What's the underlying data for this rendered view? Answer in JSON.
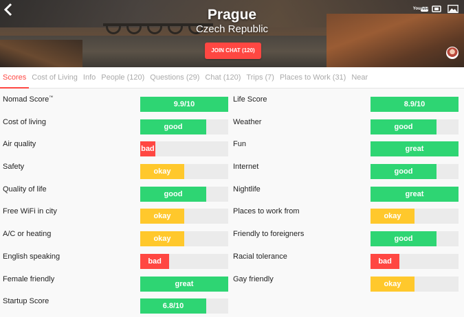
{
  "header": {
    "city": "Prague",
    "country": "Czech Republic",
    "join_chat_label": "JOIN CHAT (120)",
    "youtube_label_top": "You",
    "youtube_label_bottom": "Tube"
  },
  "tabs": [
    {
      "label": "Scores",
      "active": true
    },
    {
      "label": "Cost of Living",
      "active": false
    },
    {
      "label": "Info",
      "active": false
    },
    {
      "label": "People (120)",
      "active": false
    },
    {
      "label": "Questions (29)",
      "active": false
    },
    {
      "label": "Chat (120)",
      "active": false
    },
    {
      "label": "Trips (7)",
      "active": false
    },
    {
      "label": "Places to Work (31)",
      "active": false
    },
    {
      "label": "Near",
      "active": false
    }
  ],
  "scores_left": [
    {
      "label": "Nomad Score",
      "sup": "™",
      "value": "9.9/10",
      "level": 1.0,
      "kind": "score"
    },
    {
      "label": "Cost of living",
      "value": "good",
      "level": 0.75,
      "kind": "good"
    },
    {
      "label": "Air quality",
      "value": "bad",
      "level": 0.17,
      "kind": "bad"
    },
    {
      "label": "Safety",
      "value": "okay",
      "level": 0.5,
      "kind": "okay"
    },
    {
      "label": "Quality of life",
      "value": "good",
      "level": 0.75,
      "kind": "good"
    },
    {
      "label": "Free WiFi in city",
      "value": "okay",
      "level": 0.5,
      "kind": "okay"
    },
    {
      "label": "A/C or heating",
      "value": "okay",
      "level": 0.5,
      "kind": "okay"
    },
    {
      "label": "English speaking",
      "value": "bad",
      "level": 0.33,
      "kind": "bad"
    },
    {
      "label": "Female friendly",
      "value": "great",
      "level": 1.0,
      "kind": "great"
    },
    {
      "label": "Startup Score",
      "value": "6.8/10",
      "level": 0.75,
      "kind": "score"
    }
  ],
  "scores_right": [
    {
      "label": "Life Score",
      "value": "8.9/10",
      "level": 1.0,
      "kind": "score"
    },
    {
      "label": "Weather",
      "value": "good",
      "level": 0.75,
      "kind": "good"
    },
    {
      "label": "Fun",
      "value": "great",
      "level": 1.0,
      "kind": "great"
    },
    {
      "label": "Internet",
      "value": "good",
      "level": 0.75,
      "kind": "good"
    },
    {
      "label": "Nightlife",
      "value": "great",
      "level": 1.0,
      "kind": "great"
    },
    {
      "label": "Places to work from",
      "value": "okay",
      "level": 0.5,
      "kind": "okay"
    },
    {
      "label": "Friendly to foreigners",
      "value": "good",
      "level": 0.75,
      "kind": "good"
    },
    {
      "label": "Racial tolerance",
      "value": "bad",
      "level": 0.33,
      "kind": "bad"
    },
    {
      "label": "Gay friendly",
      "value": "okay",
      "level": 0.5,
      "kind": "okay"
    }
  ],
  "colors": {
    "accent": "#ff4742",
    "good": "#2ed573",
    "okay": "#ffc82c",
    "bad": "#ff4742",
    "track": "#ebebeb"
  },
  "icons": [
    "back-arrow-icon",
    "youtube-icon",
    "video-icon",
    "photo-icon",
    "user-avatar"
  ]
}
